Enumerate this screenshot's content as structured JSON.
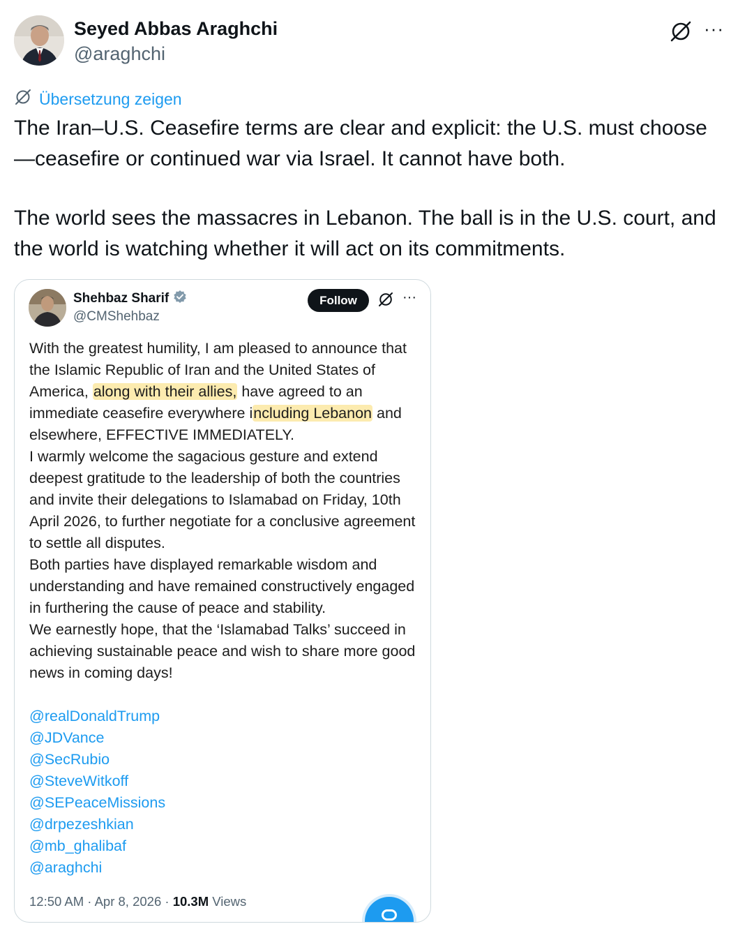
{
  "author": {
    "name": "Seyed Abbas Araghchi",
    "handle": "@araghchi"
  },
  "header": {
    "icons": [
      "grok-icon",
      "more-icon"
    ],
    "more_label": "···"
  },
  "translate": {
    "label": "Übersetzung zeigen"
  },
  "tweet": {
    "paragraphs": [
      "The Iran–U.S. Ceasefire terms are clear and explicit: the U.S. must choose—ceasefire or continued war via Israel. It cannot have both.",
      "The world sees the massacres in Lebanon. The ball is in the U.S. court, and the world is watching whether it will act on its commitments."
    ]
  },
  "embed": {
    "name": "Shehbaz Sharif",
    "handle": "@CMShehbaz",
    "follow_label": "Follow",
    "more_label": "···",
    "body": {
      "p1_a": "With the greatest humility, I am pleased to announce that the Islamic Republic of Iran and the United States of America, ",
      "p1_hl1": "along with their allies,",
      "p1_b": " have agreed to an immediate ceasefire everywhere i",
      "p1_hl2": "ncluding Lebanon",
      "p1_c": " and elsewhere, EFFECTIVE IMMEDIATELY.",
      "p2": "I warmly welcome the sagacious gesture and extend deepest gratitude to the leadership of both the countries and invite their delegations to Islamabad on Friday, 10th April 2026, to further negotiate for a conclusive agreement to settle all disputes.",
      "p3": "Both parties have displayed remarkable wisdom and understanding and have remained constructively engaged in furthering the cause of peace and stability.",
      "p4": "We earnestly hope, that the ‘Islamabad Talks’ succeed in achieving sustainable peace and wish to share more good news in coming days!"
    },
    "mentions": [
      "@realDonaldTrump",
      "@JDVance",
      "@SecRubio",
      "@SteveWitkoff",
      "@SEPeaceMissions",
      "@drpezeshkian",
      "@mb_ghalibaf",
      "@araghchi"
    ],
    "meta": {
      "time": "12:50 AM · Apr 8, 2026 · ",
      "views_count": "10.3M",
      "views_label": " Views"
    }
  },
  "colors": {
    "accent": "#1d9bf0",
    "text": "#0f1419",
    "secondary": "#536471",
    "highlight": "#fada6e"
  }
}
